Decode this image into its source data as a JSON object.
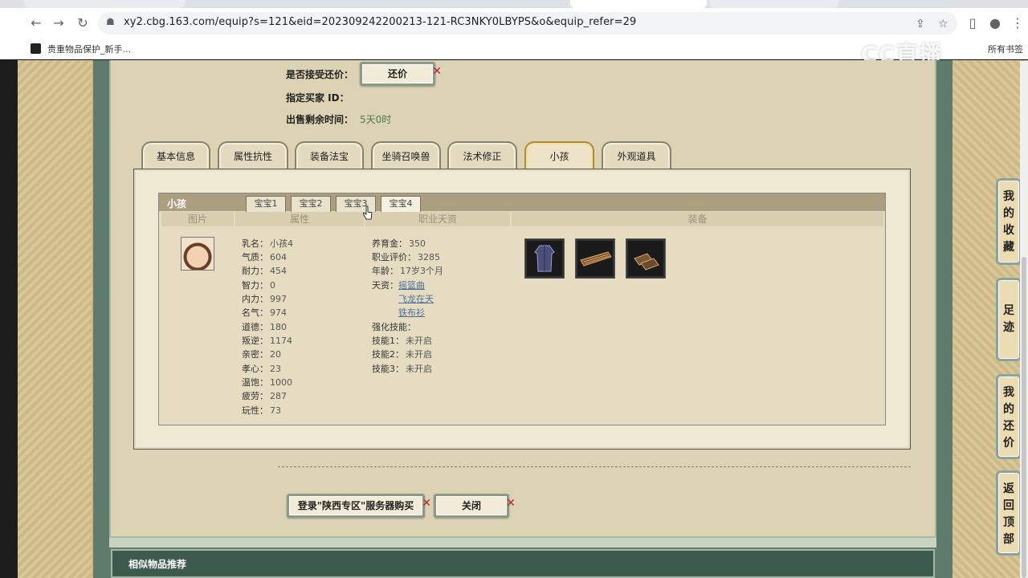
{
  "browser": {
    "url": "xy2.cbg.163.com/equip?s=121&eid=202309242200213-121-RC3NKY0LBYPS&o&equip_refer=29",
    "bookmark": "贵重物品保护_新手...",
    "bookmarks_all": "所有书签",
    "watermark": "CC直播"
  },
  "info": {
    "counter_offer_label": "是否接受还价：",
    "counter_offer_button": "还价",
    "buyer_id_label": "指定买家 ID：",
    "time_left_label": "出售剩余时间：",
    "time_left_value": "5天0时"
  },
  "tabs": [
    {
      "label": "基本信息"
    },
    {
      "label": "属性抗性"
    },
    {
      "label": "装备法宝"
    },
    {
      "label": "坐骑召唤兽"
    },
    {
      "label": "法术修正"
    },
    {
      "label": "小孩",
      "active": true
    },
    {
      "label": "外观道具"
    }
  ],
  "child": {
    "title": "小孩",
    "subtabs": [
      "宝宝1",
      "宝宝2",
      "宝宝3",
      "宝宝4"
    ],
    "active_subtab": 3,
    "columns": [
      "图片",
      "属性",
      "职业天资",
      "装备"
    ],
    "attributes": [
      {
        "k": "乳名：",
        "v": "小孩4"
      },
      {
        "k": "气质：",
        "v": "604"
      },
      {
        "k": "耐力：",
        "v": "454"
      },
      {
        "k": "智力：",
        "v": "0"
      },
      {
        "k": "内力：",
        "v": "997"
      },
      {
        "k": "名气：",
        "v": "974"
      },
      {
        "k": "道德：",
        "v": "180"
      },
      {
        "k": "叛逆：",
        "v": "1174"
      },
      {
        "k": "亲密：",
        "v": "20"
      },
      {
        "k": "孝心：",
        "v": "23"
      },
      {
        "k": "温饱：",
        "v": "1000"
      },
      {
        "k": "疲劳：",
        "v": "287"
      },
      {
        "k": "玩性：",
        "v": "73"
      }
    ],
    "career": {
      "nurture_k": "养育金：",
      "nurture_v": "350",
      "rating_k": "职业评价：",
      "rating_v": "3285",
      "age_k": "年龄：",
      "age_v": "17岁3个月",
      "talent_k": "天资：",
      "talents": [
        "摇篮曲",
        "飞龙在天",
        "铁布衫"
      ],
      "skills_title": "强化技能：",
      "skills": [
        {
          "k": "技能1：",
          "v": "未开启"
        },
        {
          "k": "技能2：",
          "v": "未开启"
        },
        {
          "k": "技能3：",
          "v": "未开启"
        }
      ]
    },
    "equipment_icons": [
      "robe-icon",
      "zither-icon",
      "shoes-icon"
    ]
  },
  "actions": {
    "buy_button": "登录\"陕西专区\"服务器购买",
    "close_button": "关闭"
  },
  "recommend_label": "相似物品推荐",
  "sidebar": [
    {
      "label": "我的收藏",
      "chars": [
        "我",
        "的",
        "收",
        "藏"
      ]
    },
    {
      "label": "足迹",
      "chars": [
        "足",
        "迹"
      ]
    },
    {
      "label": "我的还价",
      "chars": [
        "我",
        "的",
        "还",
        "价"
      ]
    },
    {
      "label": "返回顶部",
      "chars": [
        "返",
        "回",
        "顶",
        "部"
      ]
    }
  ]
}
